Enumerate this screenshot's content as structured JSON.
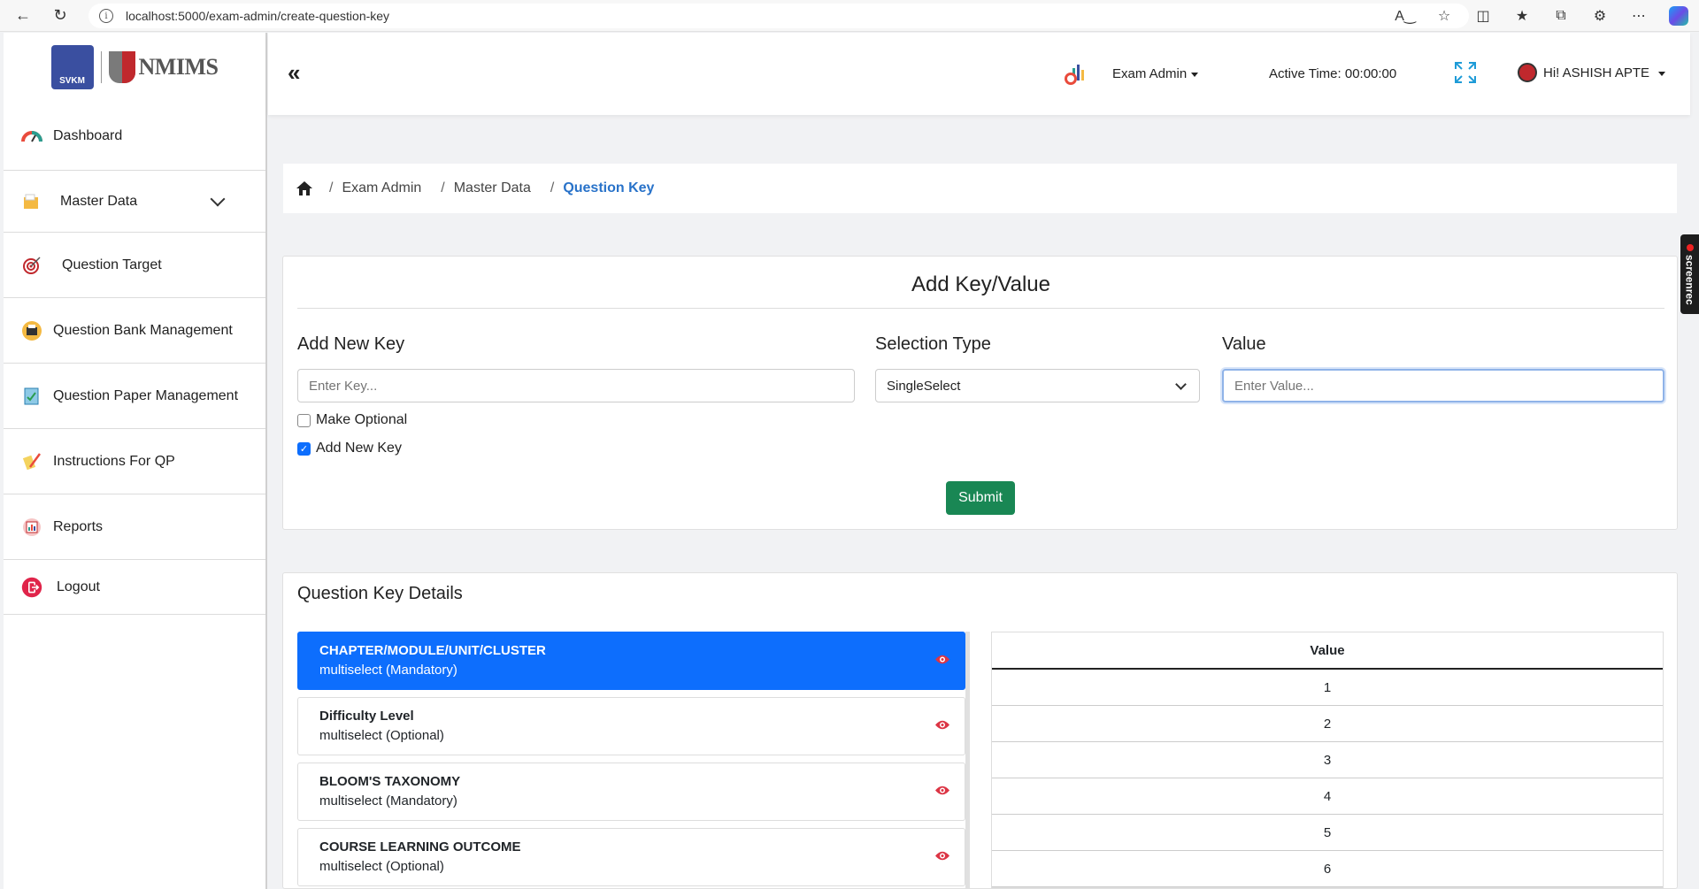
{
  "browser": {
    "url": "localhost:5000/exam-admin/create-question-key"
  },
  "sidebar": {
    "logo_text": "NMIMS",
    "items": [
      {
        "label": "Dashboard",
        "icon": "dashboard-gauge-icon"
      },
      {
        "label": "Master Data",
        "icon": "folder-icon",
        "expandable": true
      },
      {
        "label": "Question Target",
        "icon": "target-icon"
      },
      {
        "label": "Question Bank Management",
        "icon": "bank-icon"
      },
      {
        "label": "Question Paper Management",
        "icon": "paper-icon"
      },
      {
        "label": "Instructions For QP",
        "icon": "instructions-icon"
      },
      {
        "label": "Reports",
        "icon": "reports-icon"
      },
      {
        "label": "Logout",
        "icon": "logout-icon"
      }
    ]
  },
  "header": {
    "role": "Exam Admin",
    "active_time": "Active Time: 00:00:00",
    "user": "Hi! ASHISH APTE"
  },
  "breadcrumb": {
    "items": [
      "Exam Admin",
      "Master Data",
      "Question Key"
    ]
  },
  "form": {
    "title": "Add Key/Value",
    "key_label": "Add New Key",
    "key_placeholder": "Enter Key...",
    "selection_label": "Selection Type",
    "selection_value": "SingleSelect",
    "value_label": "Value",
    "value_placeholder": "Enter Value...",
    "make_optional": {
      "label": "Make Optional",
      "checked": false
    },
    "add_new_key": {
      "label": "Add New Key",
      "checked": true
    },
    "submit": "Submit"
  },
  "details": {
    "title": "Question Key Details",
    "keys": [
      {
        "name": "CHAPTER/MODULE/UNIT/CLUSTER",
        "type": "multiselect (Mandatory)",
        "active": true
      },
      {
        "name": "Difficulty Level",
        "type": "multiselect (Optional)",
        "active": false
      },
      {
        "name": "BLOOM'S TAXONOMY",
        "type": "multiselect (Mandatory)",
        "active": false
      },
      {
        "name": "COURSE LEARNING OUTCOME",
        "type": "multiselect (Optional)",
        "active": false
      }
    ],
    "value_header": "Value",
    "values": [
      "1",
      "2",
      "3",
      "4",
      "5",
      "6"
    ]
  },
  "colors": {
    "active_item": "#0d6efd",
    "submit": "#198754",
    "eye": "#dc3545",
    "breadcrumb_active": "#2872c9"
  },
  "screenrec_label": "screenrec"
}
